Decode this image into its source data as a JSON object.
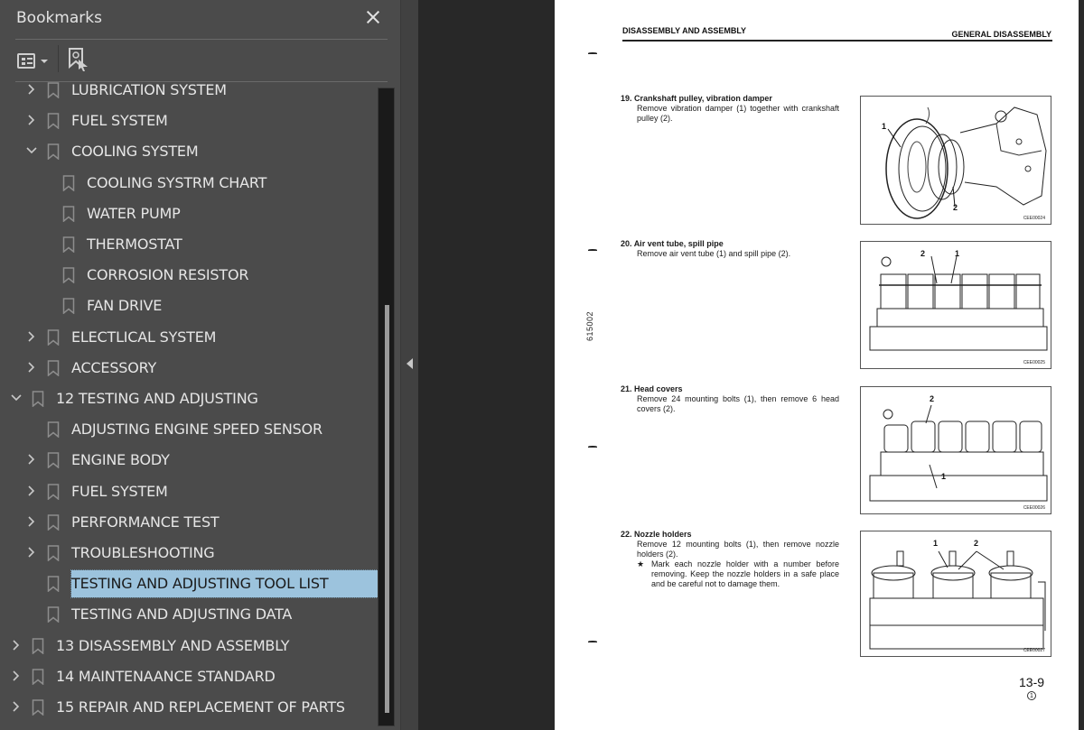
{
  "sidebar": {
    "title": "Bookmarks",
    "close_icon": "close-icon",
    "toolbar": {
      "options_icon": "list-options-icon",
      "find_bookmark_icon": "find-current-bookmark-icon"
    },
    "items": [
      {
        "label": "LUBRICATION SYSTEM",
        "level": 1,
        "expander": "collapsed"
      },
      {
        "label": "FUEL SYSTEM",
        "level": 1,
        "expander": "collapsed"
      },
      {
        "label": "COOLING SYSTEM",
        "level": 1,
        "expander": "expanded"
      },
      {
        "label": "COOLING SYSTRM CHART",
        "level": 2,
        "expander": "none"
      },
      {
        "label": "WATER PUMP",
        "level": 2,
        "expander": "none"
      },
      {
        "label": "THERMOSTAT",
        "level": 2,
        "expander": "none"
      },
      {
        "label": "CORROSION RESISTOR",
        "level": 2,
        "expander": "none"
      },
      {
        "label": "FAN DRIVE",
        "level": 2,
        "expander": "none"
      },
      {
        "label": "ELECTLICAL SYSTEM",
        "level": 1,
        "expander": "collapsed"
      },
      {
        "label": "ACCESSORY",
        "level": 1,
        "expander": "collapsed"
      },
      {
        "label": "12 TESTING AND ADJUSTING",
        "level": 0,
        "expander": "expanded"
      },
      {
        "label": "ADJUSTING ENGINE SPEED SENSOR",
        "level": 1,
        "expander": "none"
      },
      {
        "label": "ENGINE BODY",
        "level": 1,
        "expander": "collapsed"
      },
      {
        "label": "FUEL SYSTEM",
        "level": 1,
        "expander": "collapsed"
      },
      {
        "label": "PERFORMANCE TEST",
        "level": 1,
        "expander": "collapsed"
      },
      {
        "label": "TROUBLESHOOTING",
        "level": 1,
        "expander": "collapsed"
      },
      {
        "label": "TESTING AND ADJUSTING TOOL LIST",
        "level": 1,
        "expander": "none",
        "selected": true
      },
      {
        "label": "TESTING AND ADJUSTING DATA",
        "level": 1,
        "expander": "none"
      },
      {
        "label": "13 DISASSEMBLY AND ASSEMBLY",
        "level": 0,
        "expander": "collapsed"
      },
      {
        "label": "14 MAINTENAANCE STANDARD",
        "level": 0,
        "expander": "collapsed"
      },
      {
        "label": "15 REPAIR AND REPLACEMENT OF PARTS",
        "level": 0,
        "expander": "collapsed"
      }
    ],
    "scroll": {
      "position_fraction": 0.34,
      "visible_fraction": 0.64
    },
    "selection_color": "#9cc3dd"
  },
  "viewer": {
    "collapse_icon": "collapse-panel-arrow-icon"
  },
  "page": {
    "header_left": "DISASSEMBLY AND ASSEMBLY",
    "header_right": "GENERAL DISASSEMBLY",
    "side_code": "615002",
    "page_number": "13-9",
    "revision": "1",
    "steps": [
      {
        "number": "19.",
        "title": "Crankshaft pulley, vibration damper",
        "body": "Remove vibration damper (1) together with crankshaft pulley (2).",
        "figure_code": "CEE00024",
        "callouts": [
          "1",
          "2"
        ]
      },
      {
        "number": "20.",
        "title": "Air vent tube, spill pipe",
        "body": "Remove air vent tube (1) and spill pipe (2).",
        "figure_code": "CEE00025",
        "callouts": [
          "2",
          "1"
        ]
      },
      {
        "number": "21.",
        "title": "Head covers",
        "body": "Remove 24 mounting bolts (1), then remove 6 head covers (2).",
        "figure_code": "CEE00026",
        "callouts": [
          "2",
          "1"
        ]
      },
      {
        "number": "22.",
        "title": "Nozzle holders",
        "body": "Remove 12 mounting bolts (1), then remove nozzle holders (2).",
        "note_symbol": "★",
        "note": "Mark each nozzle holder with a number before removing. Keep the nozzle holders in a safe place and be careful not to damage them.",
        "figure_code": "CEE00027",
        "callouts": [
          "1",
          "2"
        ]
      }
    ]
  }
}
